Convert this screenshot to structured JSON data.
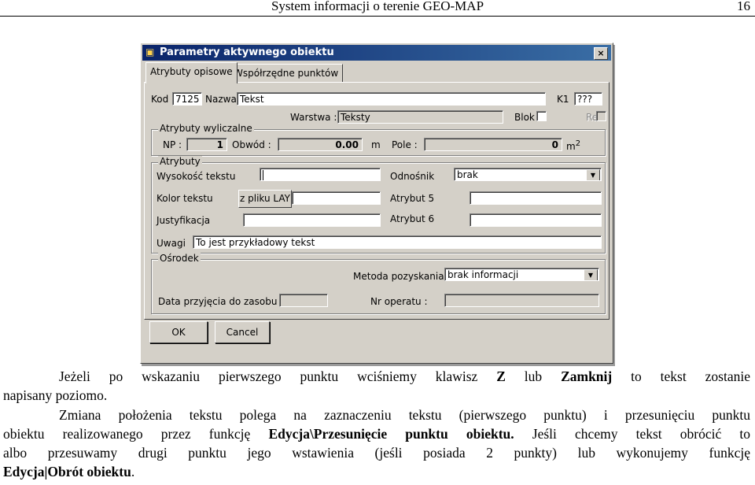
{
  "header": {
    "title": "System informacji o terenie GEO-MAP",
    "page_number": "16"
  },
  "dialog": {
    "title": "Parametry aktywnego obiektu",
    "close_label": "×",
    "tabs": [
      "Atrybuty opisowe",
      "Współrzędne punktów"
    ],
    "kod_label": "Kod",
    "kod_value": "7125",
    "nazwa_label": "Nazwa",
    "nazwa_value": "Tekst",
    "k1_label": "K1",
    "k1_value": "???",
    "warstwa_label": "Warstwa :",
    "warstwa_value": "Teksty",
    "blok_label": "Blok",
    "ref_label": "Ref",
    "calc_group": "Atrybuty wyliczalne",
    "np_label": "NP :",
    "np_value": "1",
    "obwod_label": "Obwód :",
    "obwod_value": "0.00",
    "obwod_unit": "m",
    "pole_label": "Pole :",
    "pole_value": "0",
    "pole_unit": "m",
    "pole_exp": "2",
    "attr_group": "Atrybuty",
    "wysokosc_label": "Wysokość tekstu",
    "wysokosc_value": "",
    "odnosnik_label": "Odnośnik",
    "odnosnik_value": "brak",
    "kolor_label": "Kolor tekstu",
    "kolor_button": "z pliku LAY",
    "atrybut5_label": "Atrybut 5",
    "justyfikacja_label": "Justyfikacja",
    "atrybut6_label": "Atrybut 6",
    "uwagi_label": "Uwagi",
    "uwagi_value": "To jest przykładowy tekst",
    "osrodek_group": "Ośrodek",
    "metoda_label": "Metoda pozyskania :",
    "metoda_value": "brak informacji",
    "data_label": "Data przyjęcia do zasobu :",
    "nr_label": "Nr operatu :",
    "ok_label": "OK",
    "cancel_label": "Cancel",
    "combo_arrow": "▼"
  },
  "text": {
    "p1_a": "Jeżeli po wskazaniu pierwszego punktu wciśniemy klawisz ",
    "p1_key": "Z",
    "p1_b": " lub ",
    "p1_cmd": "Zamknij",
    "p1_c": " to tekst zostanie",
    "p1_line2": "napisany poziomo.",
    "p2_line1": "Zmiana położenia tekstu polega na zaznaczeniu tekstu (pierwszego punktu) i przesunięciu punktu",
    "p2_line2_a": "obiektu realizowanego przez funkcję ",
    "p2_line2_cmd": "Edycja\\Przesunięcie punktu obiektu.",
    "p2_line2_b": " Jeśli chcemy tekst obrócić to",
    "p2_line3": "albo przesuwamy drugi punktu jego wstawienia (jeśli posiada 2 punkty) lub wykonujemy funkcję",
    "p2_line4_cmd": "Edycja|Obrót obiektu",
    "p2_line4_end": "."
  }
}
